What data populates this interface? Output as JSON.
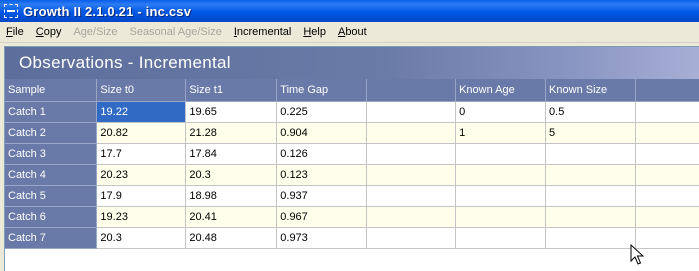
{
  "window": {
    "title": "Growth II 2.1.0.21 - inc.csv"
  },
  "menu": [
    {
      "id": "file",
      "label": "File",
      "enabled": true
    },
    {
      "id": "copy",
      "label": "Copy",
      "enabled": true
    },
    {
      "id": "age-size",
      "label": "Age/Size",
      "enabled": false
    },
    {
      "id": "seasonal-age-size",
      "label": "Seasonal Age/Size",
      "enabled": false
    },
    {
      "id": "incremental",
      "label": "Incremental",
      "enabled": true
    },
    {
      "id": "help",
      "label": "Help",
      "enabled": true
    },
    {
      "id": "about",
      "label": "About",
      "enabled": true
    }
  ],
  "panel": {
    "heading": "Observations - Incremental"
  },
  "table": {
    "columns": [
      "Sample",
      "Size t0",
      "Size t1",
      "Time Gap",
      "",
      "Known Age",
      "Known Size",
      ""
    ],
    "rows": [
      {
        "sample": "Catch 1",
        "cells": [
          "19.22",
          "19.65",
          "0.225",
          "",
          "0",
          "0.5",
          ""
        ]
      },
      {
        "sample": "Catch 2",
        "cells": [
          "20.82",
          "21.28",
          "0.904",
          "",
          "1",
          "5",
          ""
        ]
      },
      {
        "sample": "Catch 3",
        "cells": [
          "17.7",
          "17.84",
          "0.126",
          "",
          "",
          "",
          ""
        ]
      },
      {
        "sample": "Catch 4",
        "cells": [
          "20.23",
          "20.3",
          "0.123",
          "",
          "",
          "",
          ""
        ]
      },
      {
        "sample": "Catch 5",
        "cells": [
          "17.9",
          "18.98",
          "0.937",
          "",
          "",
          "",
          ""
        ]
      },
      {
        "sample": "Catch 6",
        "cells": [
          "19.23",
          "20.41",
          "0.967",
          "",
          "",
          "",
          ""
        ]
      },
      {
        "sample": "Catch 7",
        "cells": [
          "20.3",
          "20.48",
          "0.973",
          "",
          "",
          "",
          ""
        ]
      }
    ],
    "selected_cell": {
      "row": 0,
      "col": 0
    }
  },
  "colors": {
    "title_bar": "#0058E6",
    "header_accent": "#6A7AA8",
    "selection": "#316AC5",
    "alt_row": "#FFFFEB"
  }
}
